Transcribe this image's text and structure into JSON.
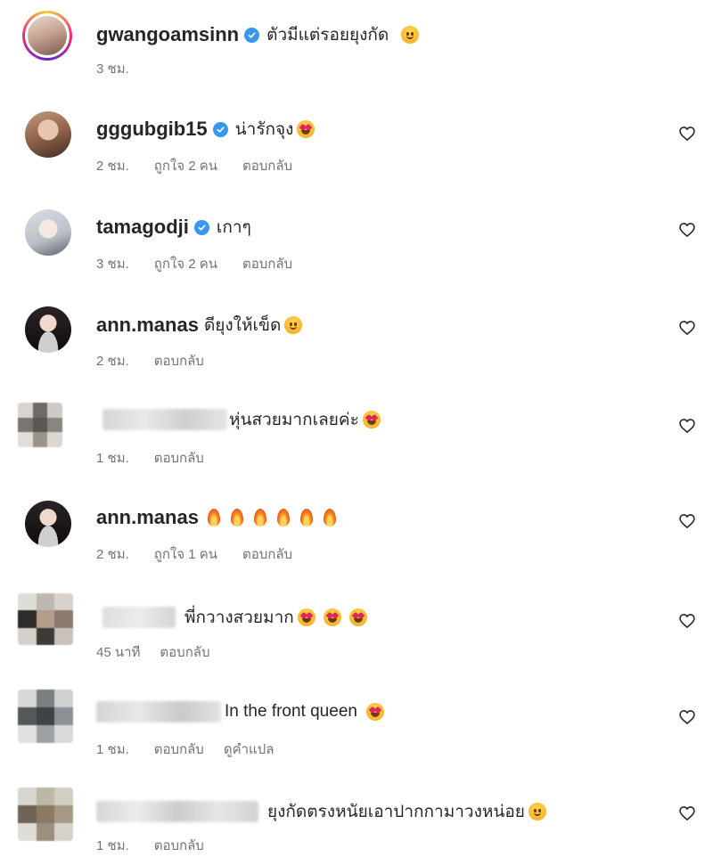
{
  "comments": [
    {
      "username": "gwangoamsinn",
      "verified": true,
      "text": "ตัวมีแต่รอยยุงกัด",
      "emoji": "pleading-face",
      "time": "3 ชม.",
      "likes": "",
      "reply": "",
      "translate": "",
      "has_heart": false
    },
    {
      "username": "gggubgib15",
      "verified": true,
      "text": "น่ารักจุง",
      "emoji": "heart-eyes",
      "time": "2 ชม.",
      "likes": "ถูกใจ 2 คน",
      "reply": "ตอบกลับ",
      "translate": "",
      "has_heart": true
    },
    {
      "username": "tamagodji",
      "verified": true,
      "text": "เกาๆ",
      "emoji": "",
      "time": "3 ชม.",
      "likes": "ถูกใจ 2 คน",
      "reply": "ตอบกลับ",
      "translate": "",
      "has_heart": true
    },
    {
      "username": "ann.manas",
      "verified": false,
      "text": "ดียุงให้เข็ด",
      "emoji": "laughing",
      "time": "2 ชม.",
      "likes": "",
      "reply": "ตอบกลับ",
      "translate": "",
      "has_heart": true
    },
    {
      "username": "",
      "verified": false,
      "text": "หุ่นสวยมากเลยค่ะ",
      "emoji": "heart-eyes",
      "time": "1 ชม.",
      "likes": "",
      "reply": "ตอบกลับ",
      "translate": "",
      "has_heart": true
    },
    {
      "username": "ann.manas",
      "verified": false,
      "text": "",
      "emoji": "fire x6",
      "time": "2 ชม.",
      "likes": "ถูกใจ 1 คน",
      "reply": "ตอบกลับ",
      "translate": "",
      "has_heart": true
    },
    {
      "username": "",
      "verified": false,
      "text": "พี่กวางสวยมาก",
      "emoji": "heart-eyes x3",
      "time": "45 นาที",
      "likes": "",
      "reply": "ตอบกลับ",
      "translate": "",
      "has_heart": true
    },
    {
      "username": "",
      "verified": false,
      "text": "In the front queen",
      "emoji": "heart-eyes",
      "time": "1 ชม.",
      "likes": "",
      "reply": "ตอบกลับ",
      "translate": "ดูคำแปล",
      "has_heart": true
    },
    {
      "username": "",
      "verified": false,
      "text": "ยุงกัดตรงหนัยเอาปากกามาวงหน่อย",
      "emoji": "smiling-sweat",
      "time": "1 ชม.",
      "likes": "",
      "reply": "ตอบกลับ",
      "translate": "",
      "has_heart": true
    }
  ],
  "colors": {
    "text": "#262626",
    "meta": "#737373",
    "verified": "#3897f0"
  }
}
